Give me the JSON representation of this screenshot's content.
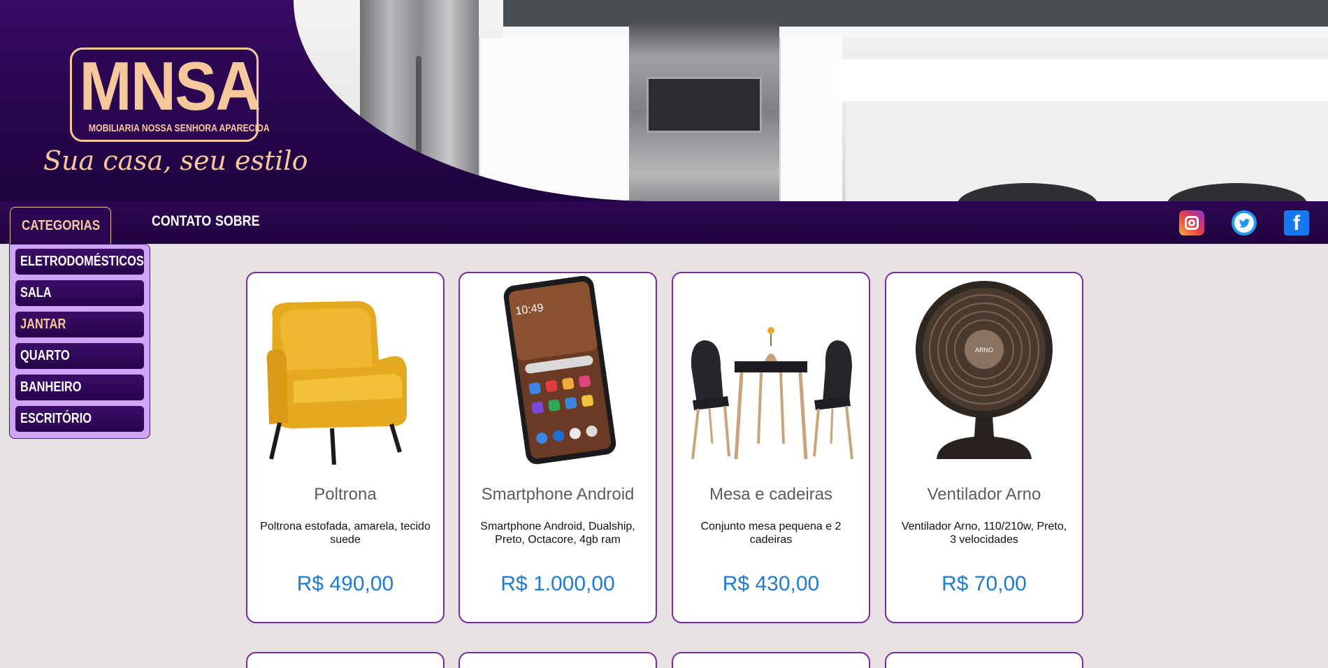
{
  "brand": {
    "logo_text": "MNSA",
    "logo_subtitle": "MOBILIARIA NOSSA SENHORA APARECIDA",
    "tagline": "Sua casa, seu estilo"
  },
  "nav": {
    "categories_label": "CATEGORIAS",
    "links": [
      "CONTATO",
      "SOBRE"
    ],
    "social": [
      "instagram-icon",
      "twitter-icon",
      "facebook-icon"
    ]
  },
  "categories": {
    "items": [
      "ELETRODOMÉSTICOS",
      "SALA",
      "JANTAR",
      "QUARTO",
      "BANHEIRO",
      "ESCRITÓRIO"
    ],
    "active": "JANTAR"
  },
  "products": [
    {
      "name": "Poltrona",
      "description": "Poltrona estofada, amarela, tecido suede",
      "price": "R$ 490,00"
    },
    {
      "name": "Smartphone Android",
      "description": "Smartphone Android, Dualship, Preto, Octacore, 4gb ram",
      "price": "R$ 1.000,00"
    },
    {
      "name": "Mesa e cadeiras",
      "description": "Conjunto mesa pequena e 2 cadeiras",
      "price": "R$ 430,00"
    },
    {
      "name": "Ventilador Arno",
      "description": "Ventilador Arno, 110/210w, Preto, 3 velocidades",
      "price": "R$ 70,00"
    }
  ],
  "phone_screen": {
    "time": "10:49"
  },
  "fan_badge": "ARNO",
  "colors": {
    "brand_purple": "#2a0650",
    "accent_peach": "#f7c89b",
    "price_blue": "#1f7ad1",
    "card_border": "#7a2aa0",
    "dropdown_bg": "#cfa6f5",
    "page_bg": "#e7e2e2"
  }
}
